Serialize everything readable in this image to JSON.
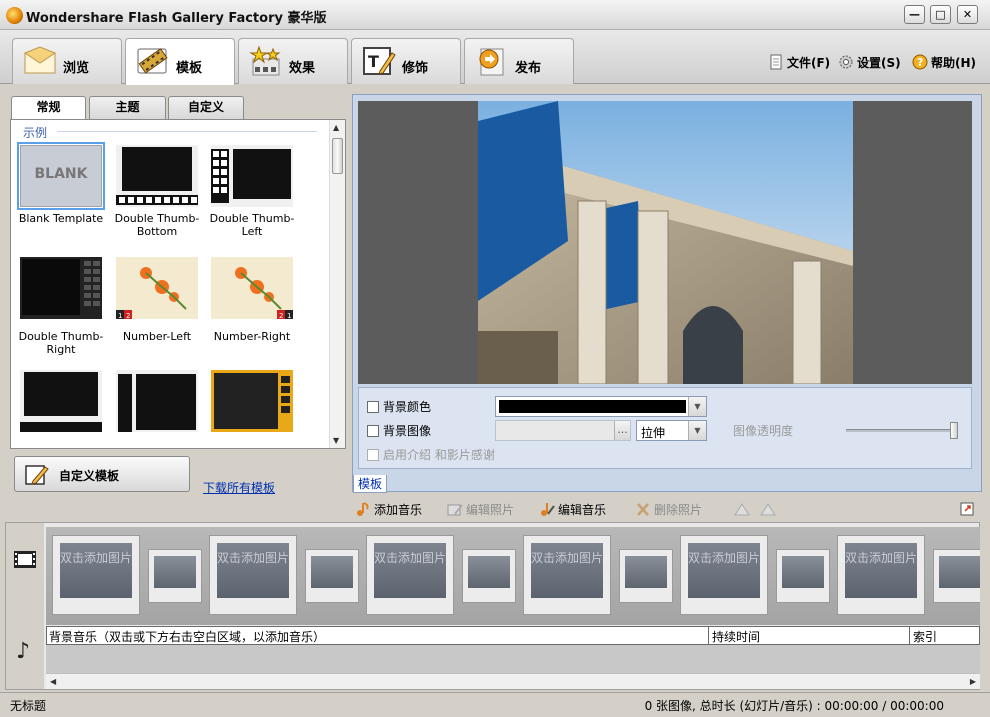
{
  "window": {
    "title": "Wondershare Flash Gallery Factory 豪华版",
    "minimize": "—",
    "maximize": "□",
    "close": "✕"
  },
  "main_tabs": [
    {
      "label": "浏览",
      "icon": "envelope-icon"
    },
    {
      "label": "模板",
      "icon": "film-template-icon",
      "active": true
    },
    {
      "label": "效果",
      "icon": "stars-effect-icon"
    },
    {
      "label": "修饰",
      "icon": "text-pencil-icon"
    },
    {
      "label": "发布",
      "icon": "publish-icon"
    }
  ],
  "top_menu": {
    "file": "文件(F)",
    "settings": "设置(S)",
    "help": "帮助(H)"
  },
  "left_panel": {
    "subtabs": [
      "常规",
      "主题",
      "自定义"
    ],
    "active_subtab": "常规",
    "section_label": "示例",
    "templates": [
      {
        "name": "Blank Template",
        "thumb_text": "BLANK",
        "selected": true
      },
      {
        "name": "Double Thumb-Bottom"
      },
      {
        "name": "Double Thumb-Left"
      },
      {
        "name": "Double Thumb-Right"
      },
      {
        "name": "Number-Left",
        "badges": [
          "1",
          "2"
        ]
      },
      {
        "name": "Number-Right",
        "badges": [
          "2",
          "1"
        ]
      },
      {
        "name": ""
      },
      {
        "name": ""
      },
      {
        "name": ""
      }
    ],
    "custom_button": "自定义模板",
    "download_link": "下载所有模板"
  },
  "right_panel": {
    "bg_color_label": "背景颜色",
    "bg_color_value": "#000000",
    "bg_image_label": "背景图像",
    "stretch_option": "拉伸",
    "opacity_label": "图像透明度",
    "intro_label": "启用介绍 和影片感谢",
    "panel_tab": "模板",
    "browse_btn": "..."
  },
  "timeline_toolbar": {
    "add_music": "添加音乐",
    "edit_photo": "编辑照片",
    "edit_music": "编辑音乐",
    "delete_photo": "删除照片"
  },
  "timeline": {
    "slot_text": "双击添加图片",
    "music_header": "背景音乐（双击或下方右击空白区域，以添加音乐）",
    "duration_header": "持续时间",
    "index_header": "索引"
  },
  "status": {
    "left": "无标题",
    "right": "0 张图像, 总时长 (幻灯片/音乐) : 00:00:00 / 00:00:00"
  }
}
